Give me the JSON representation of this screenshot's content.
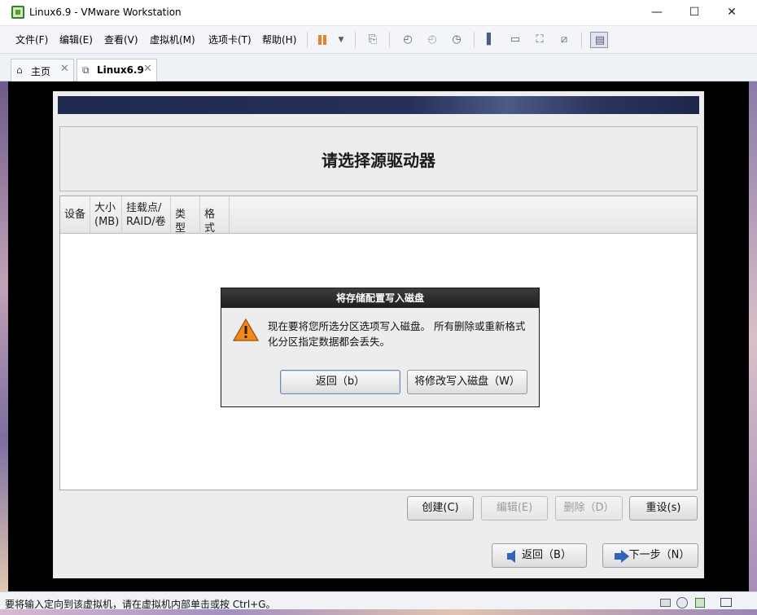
{
  "window": {
    "title": "Linux6.9 - VMware Workstation",
    "min_glyph": "—",
    "max_glyph": "☐",
    "close_glyph": "✕"
  },
  "menu": {
    "items": [
      "文件(F)",
      "编辑(E)",
      "查看(V)",
      "虚拟机(M)",
      "选项卡(T)",
      "帮助(H)"
    ]
  },
  "toolbar": {
    "icons": [
      "pause-icon",
      "dropdown-icon",
      "send-keys-icon",
      "snapshot-icon",
      "revert-snapshot-icon",
      "snapshot-manager-icon",
      "sidebar-icon",
      "thumbnail-icon",
      "fullscreen-icon",
      "unity-icon",
      "console-view-icon"
    ]
  },
  "tabs": [
    {
      "label": "主页",
      "icon": "home-icon",
      "close": "✕"
    },
    {
      "label": "Linux6.9",
      "icon": "vm-icon",
      "close": "✕"
    }
  ],
  "installer": {
    "title": "请选择源驱动器",
    "columns": [
      "设备",
      "大小\n(MB)",
      "挂载点/\nRAID/卷",
      "类型",
      "格式"
    ],
    "buttons": {
      "create": "创建(C)",
      "edit": "编辑(E)",
      "delete": "删除（D）",
      "reset": "重设(s)",
      "back": "返回（B）",
      "next": "下一步（N）"
    }
  },
  "dialog": {
    "title": "将存储配置写入磁盘",
    "message": "现在要将您所选分区选项写入磁盘。 所有删除或重新格式化分区指定数据都会丢失。",
    "back_button": "返回（b）",
    "write_button": "将修改写入磁盘（W）"
  },
  "statusbar": {
    "text": "要将输入定向到该虚拟机，请在虚拟机内部单击或按 Ctrl+G。"
  },
  "colors": {
    "banner": "#1f2a4e",
    "warning": "#f08a1c",
    "arrow": "#2f64b8",
    "pause": "#e8832b"
  }
}
